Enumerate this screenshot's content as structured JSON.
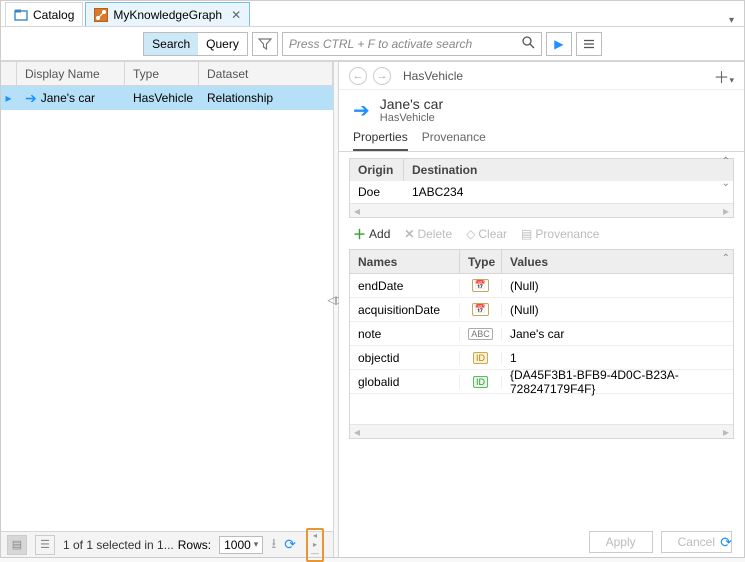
{
  "tabs": {
    "catalog": "Catalog",
    "graph": "MyKnowledgeGraph"
  },
  "search": {
    "search_label": "Search",
    "query_label": "Query",
    "placeholder": "Press CTRL + F to activate search"
  },
  "table": {
    "headers": {
      "name": "Display Name",
      "type": "Type",
      "dataset": "Dataset"
    },
    "row": {
      "name": "Jane's car",
      "type": "HasVehicle",
      "dataset": "Relationship"
    }
  },
  "detail": {
    "breadcrumb": "HasVehicle",
    "title": "Jane's car",
    "subtitle": "HasVehicle",
    "tabs": {
      "properties": "Properties",
      "provenance": "Provenance"
    },
    "origin_table": {
      "h1": "Origin",
      "h2": "Destination",
      "r1": "Doe",
      "r2": "1ABC234"
    },
    "actions": {
      "add": "Add",
      "delete": "Delete",
      "clear": "Clear",
      "provenance": "Provenance"
    },
    "props_head": {
      "names": "Names",
      "type": "Type",
      "values": "Values"
    },
    "props": [
      {
        "name": "endDate",
        "badge": "📅",
        "bclass": "tb-date",
        "value": "(Null)"
      },
      {
        "name": "acquisitionDate",
        "badge": "📅",
        "bclass": "tb-date",
        "value": "(Null)"
      },
      {
        "name": "note",
        "badge": "ABC",
        "bclass": "tb-abc",
        "value": "Jane's car"
      },
      {
        "name": "objectid",
        "badge": "ID",
        "bclass": "tb-id",
        "value": "1"
      },
      {
        "name": "globalid",
        "badge": "ID",
        "bclass": "tb-gid",
        "value": "{DA45F3B1-BFB9-4D0C-B23A-728247179F4F}"
      }
    ],
    "apply": "Apply",
    "cancel": "Cancel"
  },
  "status": {
    "text": "1 of 1 selected in 1...",
    "rows_label": "Rows:",
    "rows_value": "1000"
  }
}
